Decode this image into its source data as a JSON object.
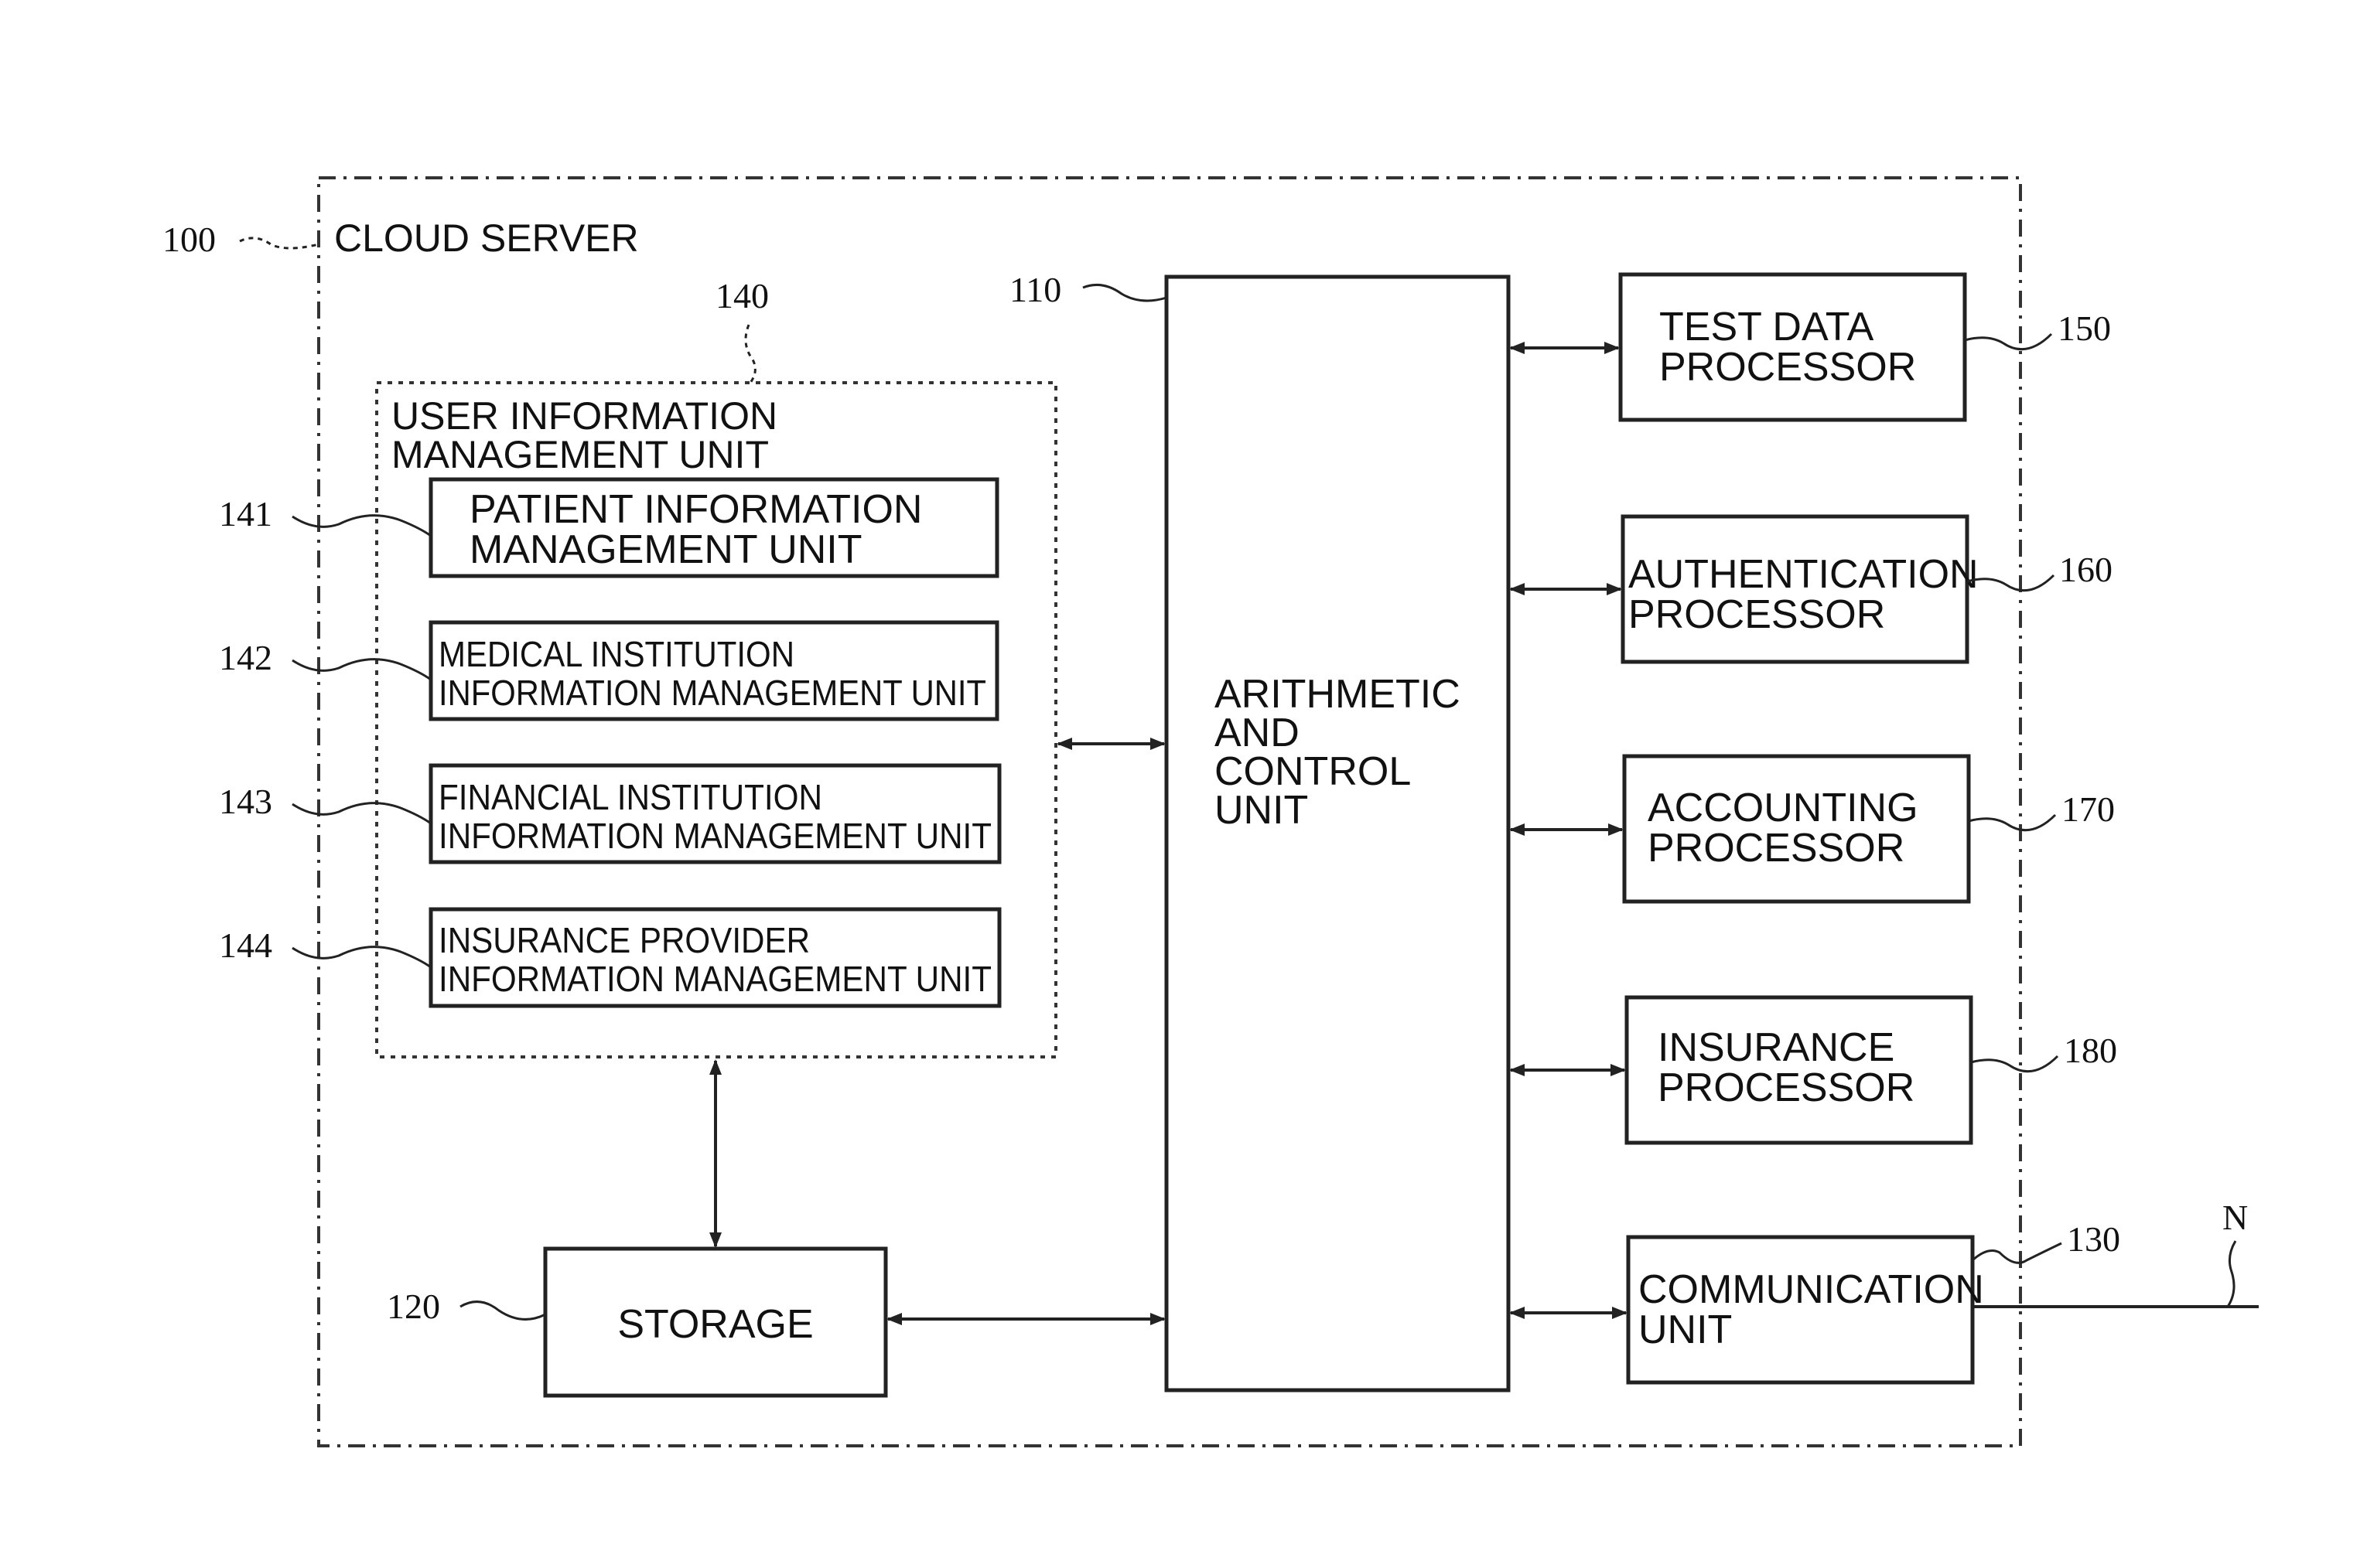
{
  "diagram": {
    "cloud_server": {
      "ref": "100",
      "label": "CLOUD SERVER"
    },
    "arithmetic_control": {
      "ref": "110",
      "lines": [
        "ARITHMETIC",
        "AND",
        "CONTROL",
        "UNIT"
      ]
    },
    "storage": {
      "ref": "120",
      "label": "STORAGE"
    },
    "communication": {
      "ref": "130",
      "lines": [
        "COMMUNICATION",
        "UNIT"
      ]
    },
    "network": {
      "ref": "N"
    },
    "user_info_mgmt": {
      "ref": "140",
      "lines": [
        "USER INFORMATION",
        "MANAGEMENT UNIT"
      ],
      "sub_units": [
        {
          "ref": "141",
          "lines": [
            "PATIENT INFORMATION",
            "MANAGEMENT UNIT"
          ]
        },
        {
          "ref": "142",
          "lines": [
            "MEDICAL INSTITUTION",
            "INFORMATION MANAGEMENT UNIT"
          ]
        },
        {
          "ref": "143",
          "lines": [
            "FINANCIAL INSTITUTION",
            "INFORMATION MANAGEMENT UNIT"
          ]
        },
        {
          "ref": "144",
          "lines": [
            "INSURANCE PROVIDER",
            "INFORMATION MANAGEMENT UNIT"
          ]
        }
      ]
    },
    "processors": [
      {
        "ref": "150",
        "lines": [
          "TEST DATA",
          "PROCESSOR"
        ]
      },
      {
        "ref": "160",
        "lines": [
          "AUTHENTICATION",
          "PROCESSOR"
        ]
      },
      {
        "ref": "170",
        "lines": [
          "ACCOUNTING",
          "PROCESSOR"
        ]
      },
      {
        "ref": "180",
        "lines": [
          "INSURANCE",
          "PROCESSOR"
        ]
      }
    ]
  }
}
